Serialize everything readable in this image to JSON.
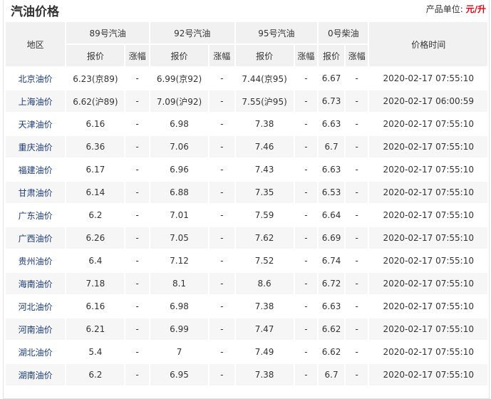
{
  "title": "汽油价格",
  "unit_label": "产品单位:",
  "unit_value": "元/升",
  "headers": {
    "region": "地区",
    "g89": "89号汽油",
    "g92": "92号汽油",
    "g95": "95号汽油",
    "d0": "0号柴油",
    "time": "价格时间",
    "price": "报价",
    "change": "涨幅"
  },
  "rows": [
    [
      "北京油价",
      "6.23(京89)",
      "-",
      "6.99(京92)",
      "-",
      "7.44(京95)",
      "-",
      "6.67",
      "-",
      "2020-02-17 07:55:10"
    ],
    [
      "上海油价",
      "6.62(沪89)",
      "-",
      "7.09(沪92)",
      "-",
      "7.55(沪95)",
      "-",
      "6.73",
      "-",
      "2020-02-17 06:00:59"
    ],
    [
      "天津油价",
      "6.16",
      "-",
      "6.98",
      "-",
      "7.38",
      "-",
      "6.63",
      "-",
      "2020-02-17 07:55:10"
    ],
    [
      "重庆油价",
      "6.36",
      "-",
      "7.06",
      "-",
      "7.46",
      "-",
      "6.7",
      "-",
      "2020-02-17 07:55:10"
    ],
    [
      "福建油价",
      "6.17",
      "-",
      "6.96",
      "-",
      "7.43",
      "-",
      "6.63",
      "-",
      "2020-02-17 07:55:10"
    ],
    [
      "甘肃油价",
      "6.14",
      "-",
      "6.88",
      "-",
      "7.35",
      "-",
      "6.53",
      "-",
      "2020-02-17 07:55:10"
    ],
    [
      "广东油价",
      "6.2",
      "-",
      "7.01",
      "-",
      "7.59",
      "-",
      "6.64",
      "-",
      "2020-02-17 07:55:10"
    ],
    [
      "广西油价",
      "6.26",
      "-",
      "7.05",
      "-",
      "7.62",
      "-",
      "6.69",
      "-",
      "2020-02-17 07:55:10"
    ],
    [
      "贵州油价",
      "6.4",
      "-",
      "7.12",
      "-",
      "7.52",
      "-",
      "6.74",
      "-",
      "2020-02-17 07:55:10"
    ],
    [
      "海南油价",
      "7.18",
      "-",
      "8.1",
      "-",
      "8.6",
      "-",
      "6.72",
      "-",
      "2020-02-17 07:55:10"
    ],
    [
      "河北油价",
      "6.16",
      "-",
      "6.98",
      "-",
      "7.38",
      "-",
      "6.63",
      "-",
      "2020-02-17 07:55:10"
    ],
    [
      "河南油价",
      "6.21",
      "-",
      "6.99",
      "-",
      "7.47",
      "-",
      "6.62",
      "-",
      "2020-02-17 07:55:10"
    ],
    [
      "湖北油价",
      "5.4",
      "-",
      "7",
      "-",
      "7.49",
      "-",
      "6.62",
      "-",
      "2020-02-17 07:55:10"
    ],
    [
      "湖南油价",
      "6.2",
      "-",
      "6.95",
      "-",
      "7.38",
      "-",
      "6.7",
      "-",
      "2020-02-17 07:55:10"
    ]
  ]
}
